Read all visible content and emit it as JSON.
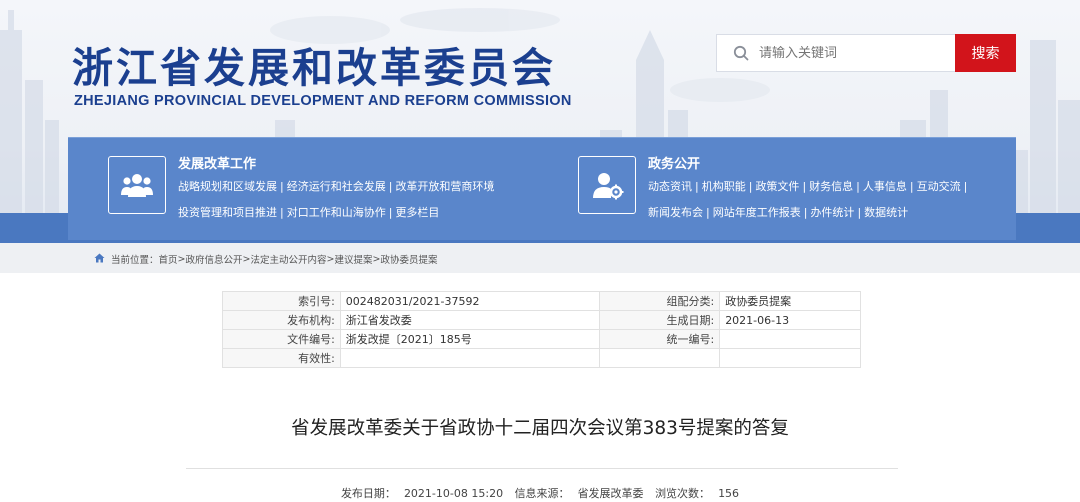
{
  "header": {
    "title_cn": "浙江省发展和改革委员会",
    "title_en": "ZHEJIANG PROVINCIAL DEVELOPMENT AND REFORM COMMISSION"
  },
  "search": {
    "placeholder": "请输入关键词",
    "button_label": "搜索"
  },
  "nav": {
    "section1": {
      "title": "发展改革工作",
      "icon": "people-group-icon",
      "row1": [
        "战略规划和区域发展",
        "经济运行和社会发展",
        "改革开放和营商环境"
      ],
      "row2": [
        "投资管理和项目推进",
        "对口工作和山海协作",
        "更多栏目"
      ]
    },
    "section2": {
      "title": "政务公开",
      "icon": "user-gear-icon",
      "row1": [
        "动态资讯",
        "机构职能",
        "政策文件",
        "财务信息",
        "人事信息",
        "互动交流"
      ],
      "row2": [
        "新闻发布会",
        "网站年度工作报表",
        "办件统计",
        "数据统计"
      ]
    }
  },
  "breadcrumb": {
    "prefix": "当前位置：",
    "items": [
      "首页",
      "政府信息公开",
      "法定主动公开内容",
      "建议提案",
      "政协委员提案"
    ],
    "separator": ">"
  },
  "info_table": {
    "rows": [
      [
        "索引号:",
        "002482031/2021-37592",
        "组配分类:",
        "政协委员提案"
      ],
      [
        "发布机构:",
        "浙江省发改委",
        "生成日期:",
        "2021-06-13"
      ],
      [
        "文件编号:",
        "浙发改提〔2021〕185号",
        "统一编号:",
        ""
      ],
      [
        "有效性:",
        "",
        "",
        ""
      ]
    ]
  },
  "document": {
    "title": "省发展改革委关于省政协十二届四次会议第383号提案的答复",
    "publish_date_label": "发布日期：",
    "publish_date": "2021-10-08 15:20",
    "source_label": "信息来源：",
    "source": "省发展改革委",
    "views_label": "浏览次数：",
    "views": "156"
  },
  "colors": {
    "brand_blue": "#1b3f8f",
    "nav_blue": "#5a86cb",
    "search_red": "#d2141b"
  }
}
